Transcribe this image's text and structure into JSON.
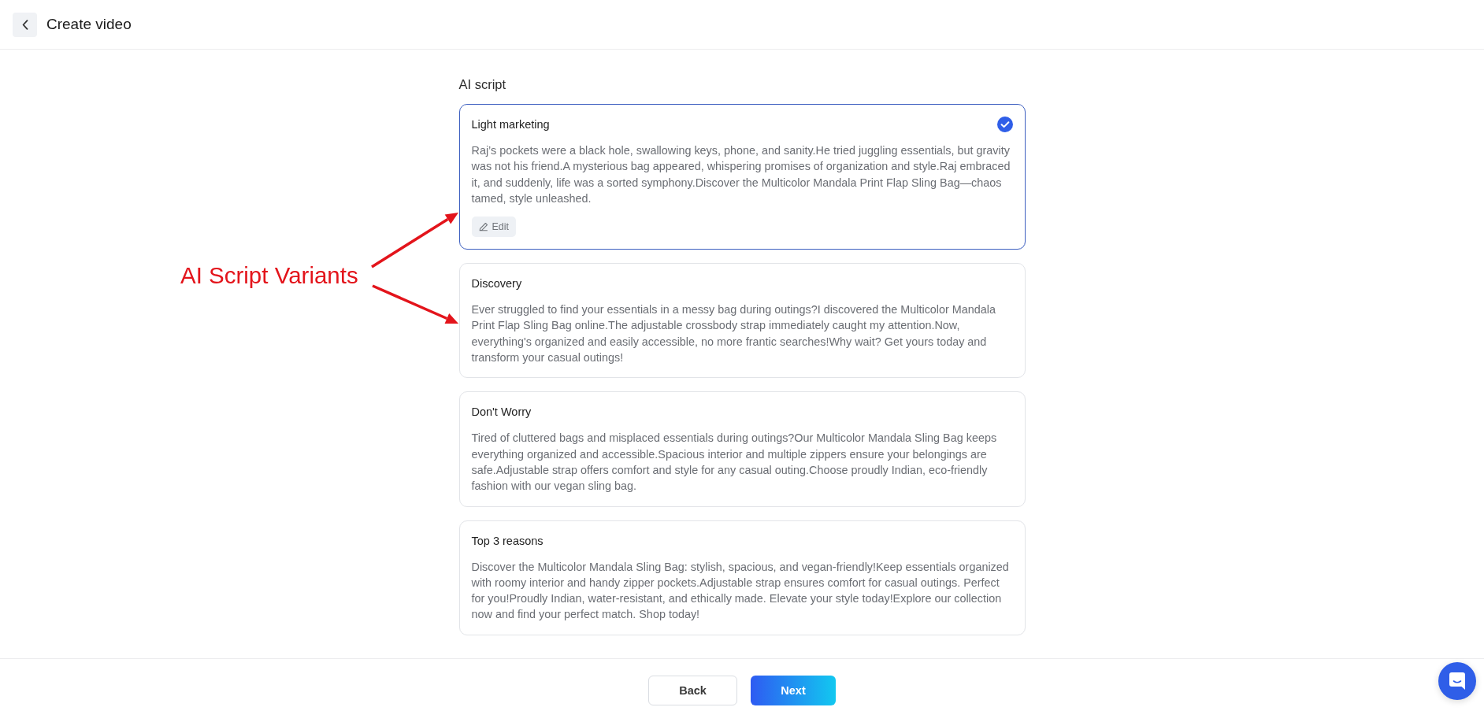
{
  "header": {
    "title": "Create video"
  },
  "section": {
    "label": "AI script"
  },
  "scripts": [
    {
      "title": "Light marketing",
      "text": "Raj’s pockets were a black hole, swallowing keys, phone, and sanity.He tried juggling essentials, but gravity was not his friend.A mysterious bag appeared, whispering promises of organization and style.Raj embraced it, and suddenly, life was a sorted symphony.Discover the Multicolor Mandala Print Flap Sling Bag—chaos tamed, style unleashed.",
      "selected": true,
      "edit_label": "Edit"
    },
    {
      "title": "Discovery",
      "text": "Ever struggled to find your essentials in a messy bag during outings?I discovered the Multicolor Mandala Print Flap Sling Bag online.The adjustable crossbody strap immediately caught my attention.Now, everything's organized and easily accessible, no more frantic searches!Why wait? Get yours today and transform your casual outings!",
      "selected": false
    },
    {
      "title": "Don't Worry",
      "text": "Tired of cluttered bags and misplaced essentials during outings?Our Multicolor Mandala Sling Bag keeps everything organized and accessible.Spacious interior and multiple zippers ensure your belongings are safe.Adjustable strap offers comfort and style for any casual outing.Choose proudly Indian, eco-friendly fashion with our vegan sling bag.",
      "selected": false
    },
    {
      "title": "Top 3 reasons",
      "text": "Discover the Multicolor Mandala Sling Bag: stylish, spacious, and vegan-friendly!Keep essentials organized with roomy interior and handy zipper pockets.Adjustable strap ensures comfort for casual outings. Perfect for you!Proudly Indian, water-resistant, and ethically made. Elevate your style today!Explore our collection now and find your perfect match. Shop today!",
      "selected": false
    }
  ],
  "annotation": {
    "label": "AI Script Variants"
  },
  "footer": {
    "buttons": [
      {
        "label": "Back",
        "kind": "secondary"
      },
      {
        "label": "Next",
        "kind": "primary"
      }
    ]
  }
}
